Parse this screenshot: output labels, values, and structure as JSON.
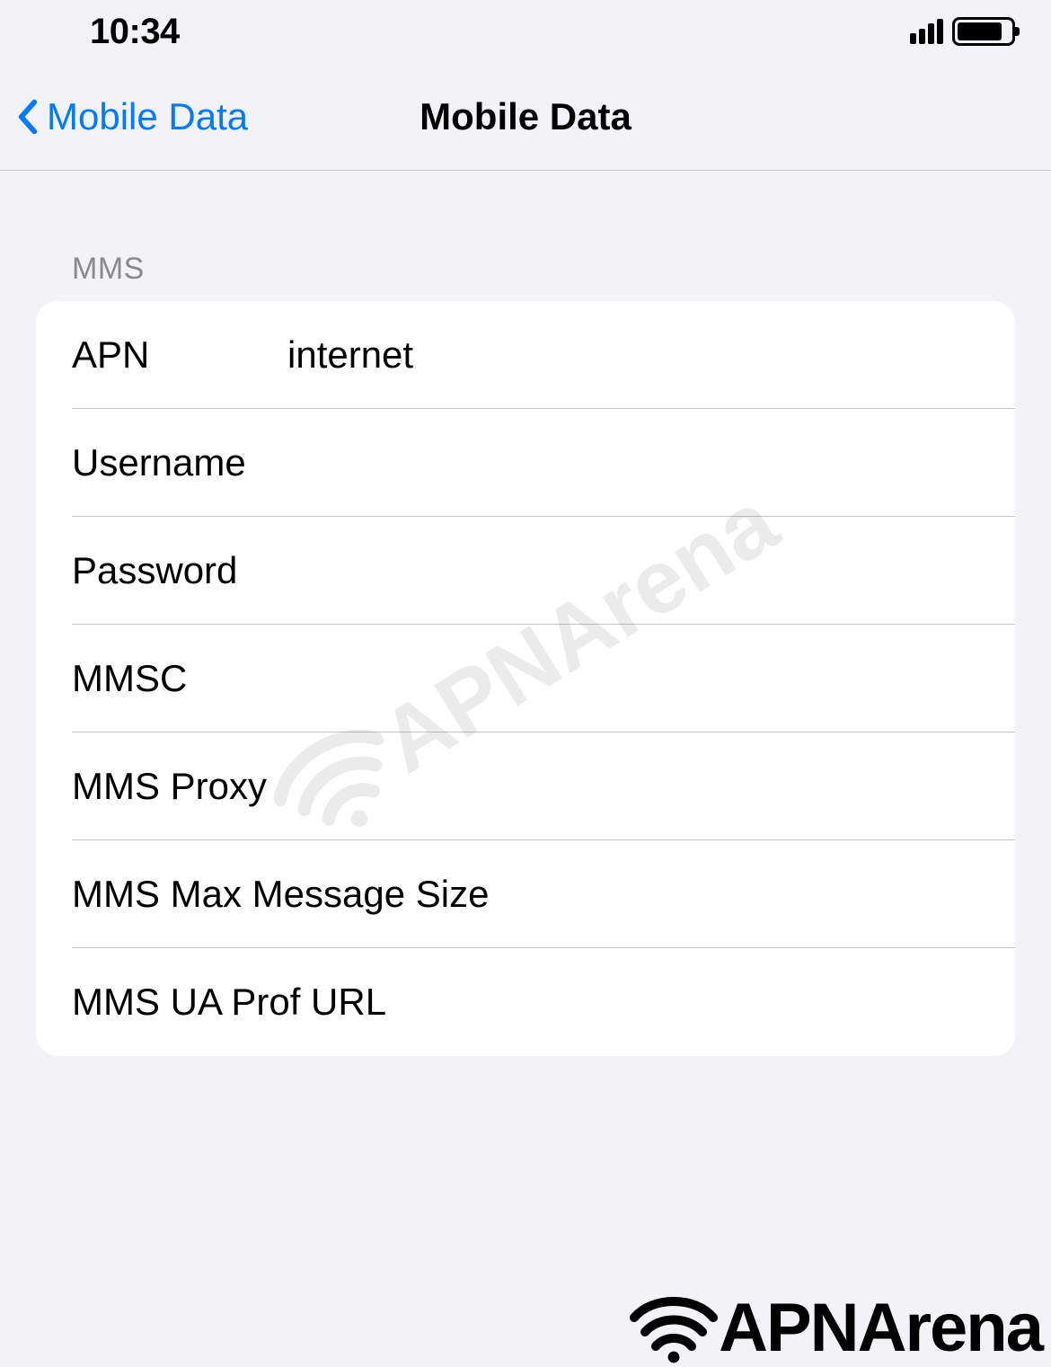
{
  "statusBar": {
    "time": "10:34"
  },
  "navBar": {
    "backLabel": "Mobile Data",
    "title": "Mobile Data"
  },
  "section": {
    "header": "MMS",
    "rows": [
      {
        "label": "APN",
        "value": "internet"
      },
      {
        "label": "Username",
        "value": ""
      },
      {
        "label": "Password",
        "value": ""
      },
      {
        "label": "MMSC",
        "value": ""
      },
      {
        "label": "MMS Proxy",
        "value": ""
      },
      {
        "label": "MMS Max Message Size",
        "value": ""
      },
      {
        "label": "MMS UA Prof URL",
        "value": ""
      }
    ]
  },
  "watermark": {
    "text": "APNArena"
  },
  "footer": {
    "brand": "APNArena"
  }
}
